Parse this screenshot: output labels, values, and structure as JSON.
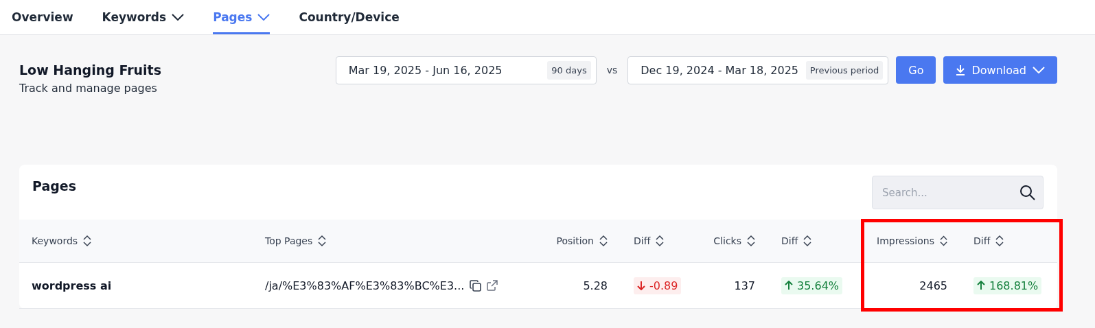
{
  "tabs": [
    {
      "label": "Overview",
      "selected": false,
      "dropdown": false
    },
    {
      "label": "Keywords",
      "selected": false,
      "dropdown": true
    },
    {
      "label": "Pages",
      "selected": true,
      "dropdown": true
    },
    {
      "label": "Country/Device",
      "selected": false,
      "dropdown": false
    }
  ],
  "header": {
    "title": "Low Hanging Fruits",
    "subtitle": "Track and manage pages"
  },
  "date_range": {
    "value": "Mar 19, 2025 - Jun 16, 2025",
    "badge": "90 days"
  },
  "vs_label": "vs",
  "compare_range": {
    "value": "Dec 19, 2024 - Mar 18, 2025",
    "badge": "Previous period"
  },
  "go_button": "Go",
  "download_button": "Download",
  "table": {
    "title": "Pages",
    "search": {
      "placeholder": "Search..."
    },
    "columns": [
      {
        "label": "Keywords",
        "highlighted": false
      },
      {
        "label": "Top Pages",
        "highlighted": false
      },
      {
        "label": "Position",
        "highlighted": false
      },
      {
        "label": "Diff",
        "highlighted": false
      },
      {
        "label": "Clicks",
        "highlighted": false
      },
      {
        "label": "Diff",
        "highlighted": false
      },
      {
        "label": "Impressions",
        "highlighted": true
      },
      {
        "label": "Diff",
        "highlighted": true
      }
    ],
    "rows": [
      {
        "cells": [
          {
            "kind": "bold",
            "text": "wordpress ai"
          },
          {
            "kind": "url",
            "text": "/ja/%E3%83%AF%E3%83%BC%E3..."
          },
          {
            "kind": "number",
            "text": "5.28"
          },
          {
            "kind": "decrease",
            "text": "-0.89"
          },
          {
            "kind": "number",
            "text": "137"
          },
          {
            "kind": "increase",
            "text": "35.64%"
          },
          {
            "kind": "number",
            "text": "2465"
          },
          {
            "kind": "increase",
            "text": "168.81%"
          }
        ]
      }
    ]
  }
}
